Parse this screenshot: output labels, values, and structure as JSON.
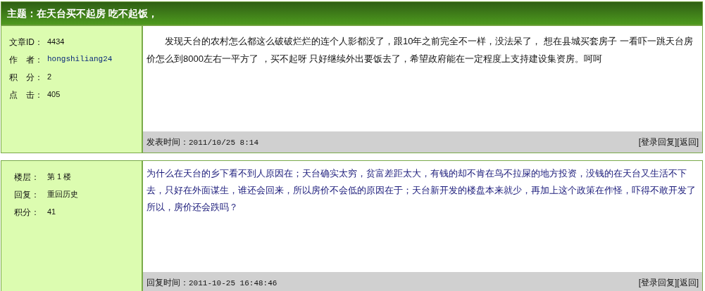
{
  "topic": "主题：在天台买不起房 吃不起饭，",
  "posts": [
    {
      "kind": "topic",
      "info": [
        {
          "label": "文章ID：",
          "value": "4434",
          "link": false
        },
        {
          "label": "作　者：",
          "value": "hongshiliang24",
          "link": true
        },
        {
          "label": "积　分：",
          "value": "2",
          "link": false
        },
        {
          "label": "点　击：",
          "value": "405",
          "link": false
        }
      ],
      "body": "发现天台的农村怎么都这么破破烂烂的连个人影都没了，跟10年之前完全不一样，没法呆了， 想在县城买套房子 一看吓一跳天台房价怎么到8000左右一平方了 ，买不起呀 只好继续外出要饭去了，希望政府能在一定程度上支持建设集资房。呵呵",
      "footer_label": "发表时间：",
      "footer_time": "2011/10/25 8:14",
      "actions": [
        "[登录回复]",
        "[返回]"
      ]
    },
    {
      "kind": "reply",
      "info": [
        {
          "label": "楼层：",
          "value": "第 1 楼",
          "link": false
        },
        {
          "label": "回复：",
          "value": "重回历史",
          "link": false
        },
        {
          "label": "积分：",
          "value": "41",
          "link": false
        }
      ],
      "body": "为什么在天台的乡下看不到人原因在；天台确实太穷，贫富差距太大，有钱的却不肯在鸟不拉屎的地方投资，没钱的在天台又生活不下去，只好在外面谋生，谁还会回来，所以房价不会低的原因在于；天台新开发的楼盘本来就少，再加上这个政策在作怪，吓得不敢开发了所以，房价还会跌吗？",
      "footer_label": "回复时间：",
      "footer_time": "2011-10-25 16:48:46",
      "actions": [
        "[登录回复]",
        "[返回]"
      ]
    }
  ]
}
